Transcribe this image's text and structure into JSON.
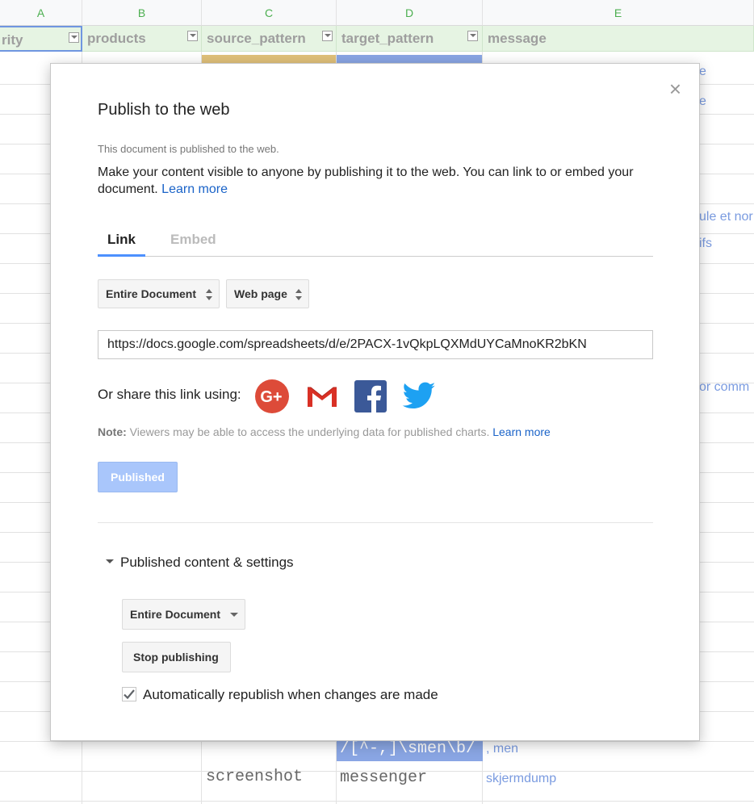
{
  "sheet": {
    "col_letters": [
      "A",
      "B",
      "C",
      "D",
      "E"
    ],
    "headers": [
      "rity",
      "products",
      "source_pattern",
      "target_pattern",
      "message"
    ],
    "right_fragments": [
      "e",
      "e",
      "ule et nor",
      "ifs",
      "or comm"
    ],
    "bottom_row1": {
      "d": "/[^-,]\\smen\\b/",
      "e": ", men"
    },
    "bottom_row2": {
      "c": "screenshot",
      "d": "messenger",
      "e": "skjermdump"
    }
  },
  "dialog": {
    "close_glyph": "×",
    "title": "Publish to the web",
    "status": "This document is published to the web.",
    "description": "Make your content visible to anyone by publishing it to the web. You can link to or embed your document.",
    "learn_more": "Learn more",
    "tabs": [
      "Link",
      "Embed"
    ],
    "scope_select": "Entire Document",
    "format_select": "Web page",
    "url": "https://docs.google.com/spreadsheets/d/e/2PACX-1vQkpLQXMdUYCaMnoKR2bKN",
    "share_label": "Or share this link using:",
    "share_icons": [
      "google-plus-icon",
      "gmail-icon",
      "facebook-icon",
      "twitter-icon"
    ],
    "note_label": "Note:",
    "note_text": "Viewers may be able to access the underlying data for published charts.",
    "note_learn_more": "Learn more",
    "published_button": "Published",
    "section_title": "Published content & settings",
    "settings_select": "Entire Document",
    "stop_button": "Stop publishing",
    "auto_republish_label": "Automatically republish when changes are made",
    "auto_republish_checked": true
  },
  "colors": {
    "accent_blue": "#4d90fe",
    "link_blue": "#1a63c8",
    "published_bg": "#a9c6fb",
    "header_green": "#e6f4e3"
  }
}
